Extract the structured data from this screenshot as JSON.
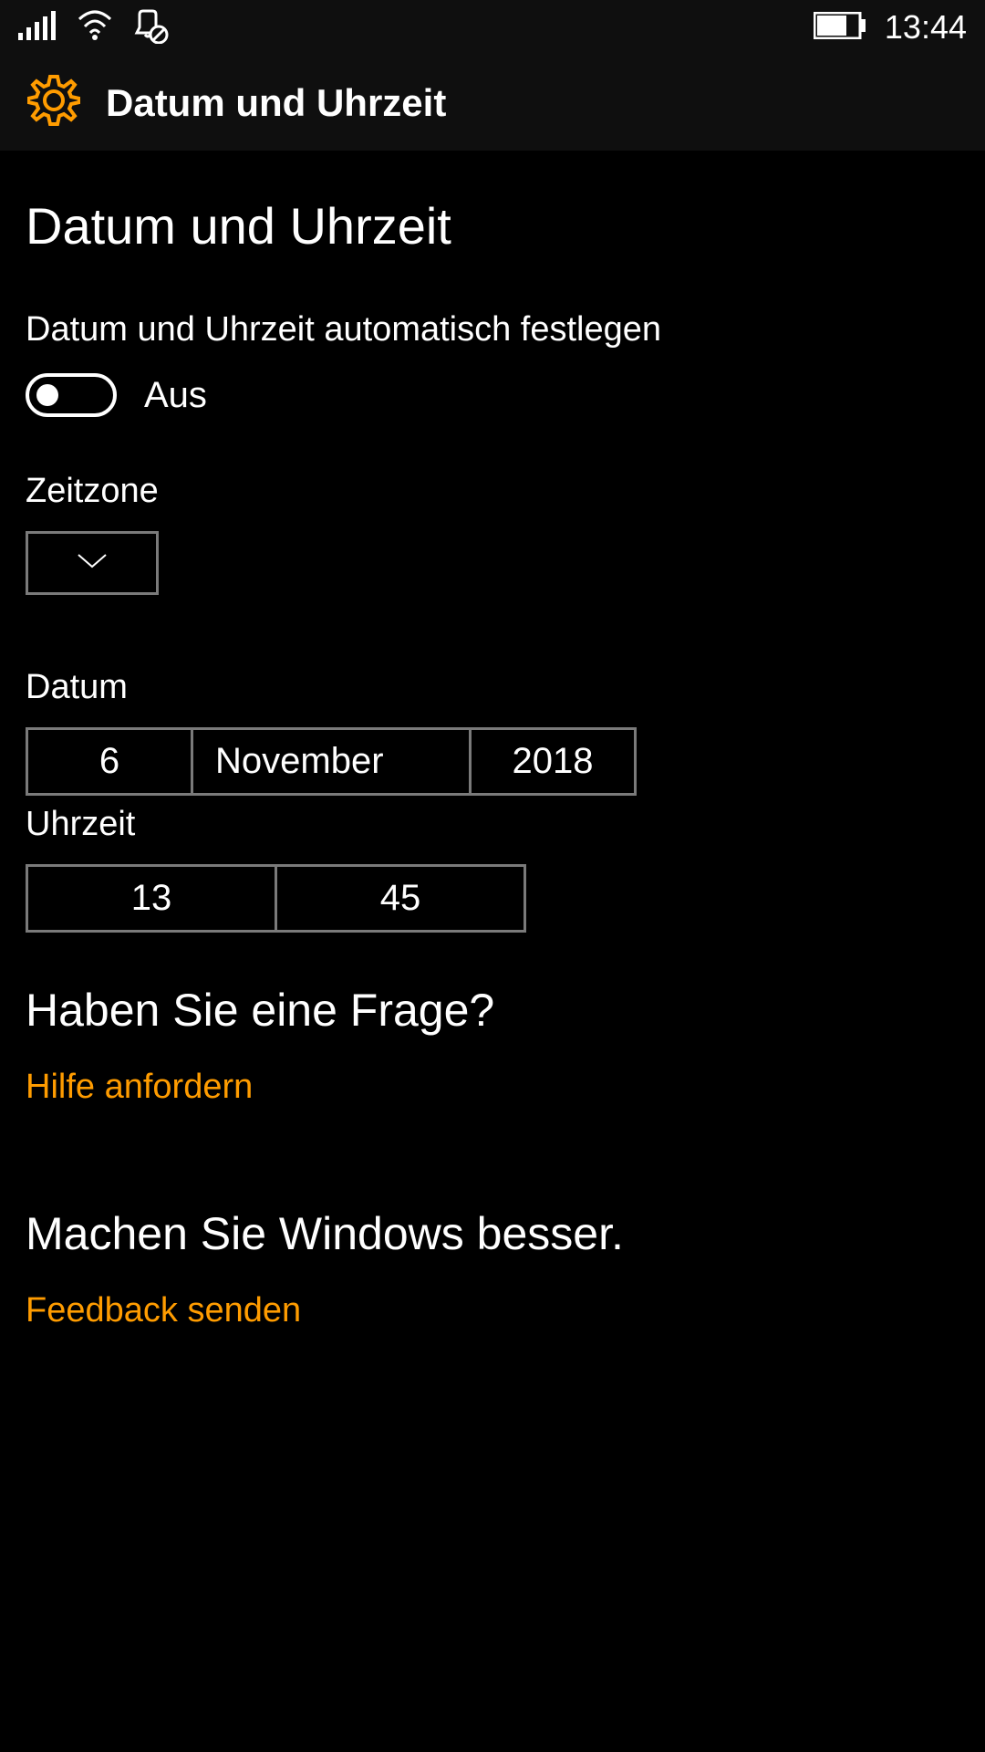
{
  "statusBar": {
    "time": "13:44"
  },
  "header": {
    "title": "Datum und Uhrzeit"
  },
  "page": {
    "title": "Datum und Uhrzeit"
  },
  "autoSet": {
    "label": "Datum und Uhrzeit automatisch festlegen",
    "state": "Aus"
  },
  "timezone": {
    "label": "Zeitzone"
  },
  "date": {
    "label": "Datum",
    "day": "6",
    "month": "November",
    "year": "2018"
  },
  "time": {
    "label": "Uhrzeit",
    "hour": "13",
    "minute": "45"
  },
  "help": {
    "heading": "Haben Sie eine Frage?",
    "link": "Hilfe anfordern"
  },
  "feedback": {
    "heading": "Machen Sie Windows besser.",
    "link": "Feedback senden"
  }
}
